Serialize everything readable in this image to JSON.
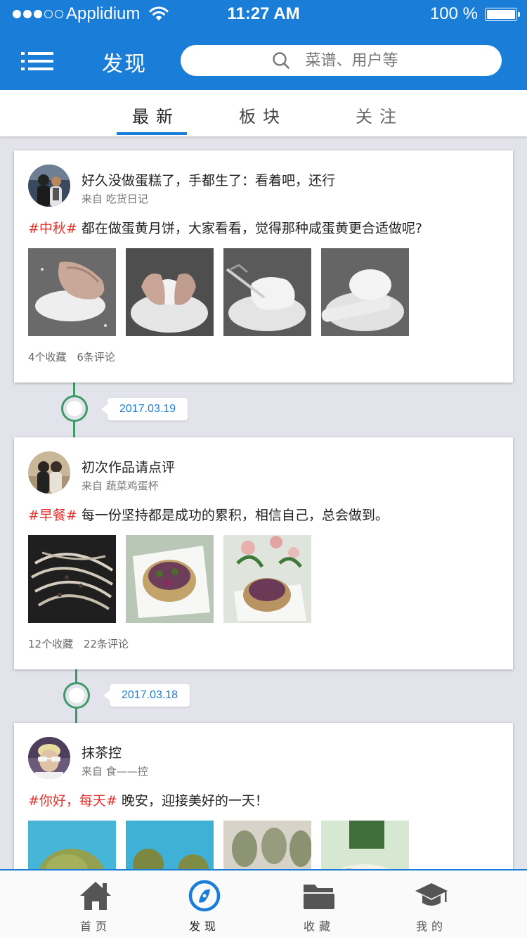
{
  "status_bar": {
    "carrier": "Applidium",
    "time": "11:27 AM",
    "battery": "100 %",
    "signal_bars_filled": 3,
    "signal_bars_total": 5,
    "battery_level": 1.0
  },
  "header": {
    "title": "发现",
    "search_placeholder": "菜谱、用户等",
    "menu_icon": "hamburger-menu-icon",
    "search_icon": "magnifier-icon"
  },
  "tabs": [
    {
      "label": "最新",
      "active": true
    },
    {
      "label": "板块",
      "active": false
    },
    {
      "label": "关注",
      "active": false
    }
  ],
  "posts": [
    {
      "title": "好久没做蛋糕了，手都生了：看着吧，还行",
      "source_prefix": "来自",
      "source": "吃货日记",
      "hashtag": "#中秋#",
      "text": "都在做蛋黄月饼，大家看看，觉得那种咸蛋黄更合适做呢?",
      "favorites": "4个收藏",
      "comments": "6条评论"
    },
    {
      "title": "初次作品请点评",
      "source_prefix": "来自",
      "source": "蔬菜鸡蛋杯",
      "hashtag": "#早餐#",
      "text": "每一份坚持都是成功的累积，相信自己，总会做到。",
      "favorites": "12个收藏",
      "comments": "22条评论"
    },
    {
      "title": "抹茶控",
      "source_prefix": "来自",
      "source": "食——控",
      "hashtag": "#你好，每天#",
      "text": "晚安，迎接美好的一天！"
    }
  ],
  "timeline_dates": [
    "2017.03.19",
    "2017.03.18"
  ],
  "bottom_nav": [
    {
      "label": "首页",
      "icon": "home-icon",
      "active": false
    },
    {
      "label": "发现",
      "icon": "compass-icon",
      "active": true
    },
    {
      "label": "收藏",
      "icon": "folder-icon",
      "active": false
    },
    {
      "label": "我的",
      "icon": "graduation-cap-icon",
      "active": false
    }
  ],
  "colors": {
    "primary": "#1a7ed9",
    "hashtag": "#e5312b",
    "timeline": "#3f9a6a",
    "background": "#e3e3ec"
  }
}
